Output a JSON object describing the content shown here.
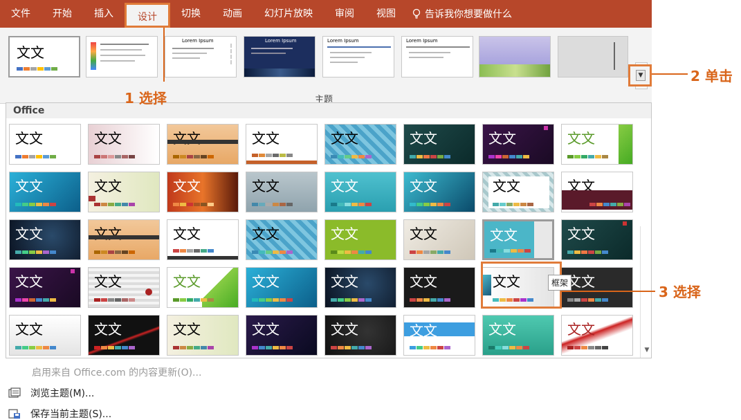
{
  "tabs": [
    {
      "label": "文件"
    },
    {
      "label": "开始"
    },
    {
      "label": "插入"
    },
    {
      "label": "设计",
      "active": true
    },
    {
      "label": "切换"
    },
    {
      "label": "动画"
    },
    {
      "label": "幻灯片放映"
    },
    {
      "label": "审阅"
    },
    {
      "label": "视图"
    }
  ],
  "tell_me": "告诉我你想要做什么",
  "gallery": {
    "section_label": "主题",
    "first_thumb_text": "文文",
    "sample_title": "Lorem Ipsum"
  },
  "panel": {
    "header": "Office",
    "thumb_text": "文文",
    "tooltip": "框架"
  },
  "menu": {
    "update": "启用来自 Office.com 的内容更新(O)...",
    "browse": "浏览主题(M)...",
    "save": "保存当前主题(S)..."
  },
  "annotations": {
    "a1_num": "1",
    "a1_text": "选择",
    "a2_num": "2",
    "a2_text": "单击",
    "a3_num": "3",
    "a3_text": "选择"
  },
  "colors": {
    "ribbon": "#b7472a",
    "accent": "#e07b39",
    "annotation": "#d9651a"
  }
}
